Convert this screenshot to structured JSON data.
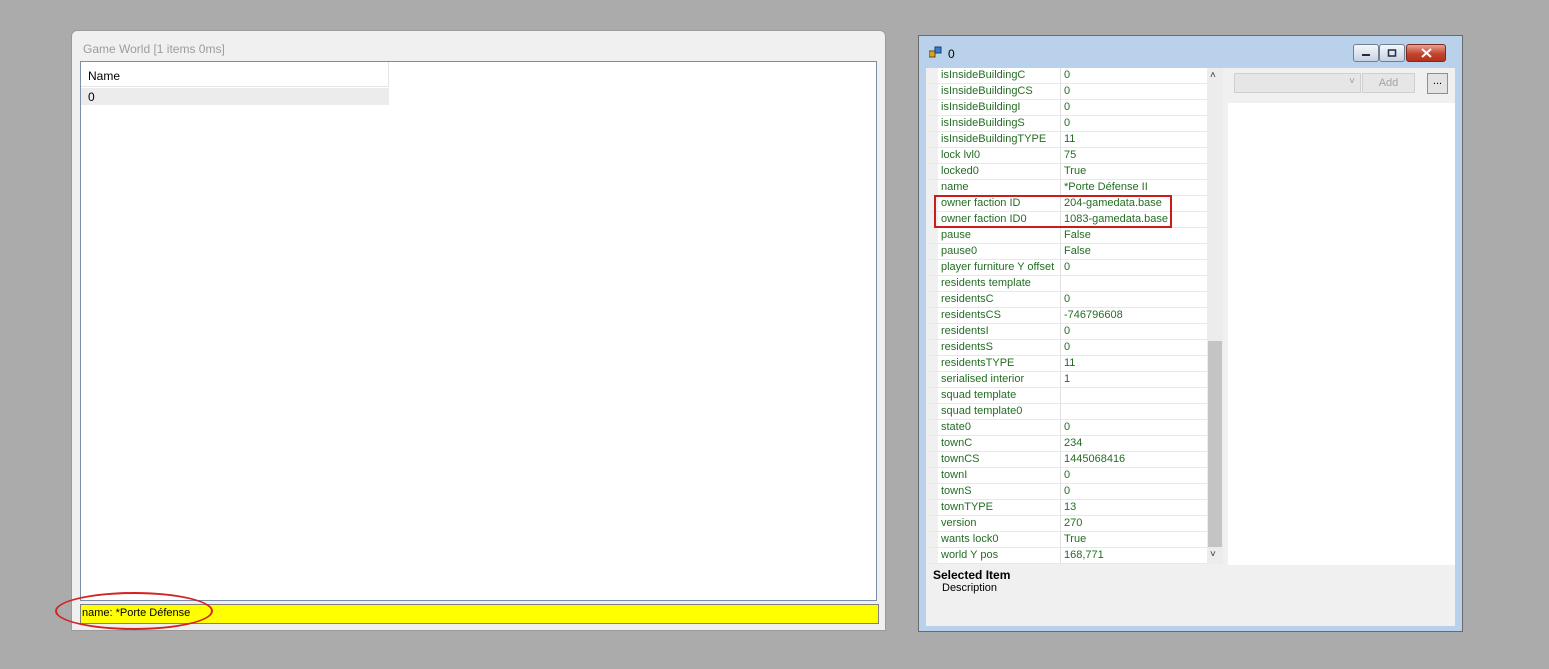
{
  "colors": {
    "desktop": "#ababab",
    "status_bar": "#ffff00",
    "property_text": "#226e22",
    "annotation": "#d42222"
  },
  "game_world": {
    "title": "Game World [1 items 0ms]",
    "column_header": "Name",
    "rows": [
      "0"
    ],
    "status_text": "name: *Porte Défense"
  },
  "property_window": {
    "title": "0",
    "icon": "app-icon",
    "properties": [
      {
        "name": "isInsideBuildingC",
        "value": "0"
      },
      {
        "name": "isInsideBuildingCS",
        "value": "0"
      },
      {
        "name": "isInsideBuildingI",
        "value": "0"
      },
      {
        "name": "isInsideBuildingS",
        "value": "0"
      },
      {
        "name": "isInsideBuildingTYPE",
        "value": "11"
      },
      {
        "name": "lock lvl0",
        "value": "75"
      },
      {
        "name": "locked0",
        "value": "True"
      },
      {
        "name": "name",
        "value": "*Porte Défense II"
      },
      {
        "name": "owner faction ID",
        "value": "204-gamedata.base"
      },
      {
        "name": "owner faction ID0",
        "value": "1083-gamedata.base"
      },
      {
        "name": "pause",
        "value": "False"
      },
      {
        "name": "pause0",
        "value": "False"
      },
      {
        "name": "player furniture Y offset",
        "value": "0"
      },
      {
        "name": "residents template",
        "value": ""
      },
      {
        "name": "residentsC",
        "value": "0"
      },
      {
        "name": "residentsCS",
        "value": "-746796608"
      },
      {
        "name": "residentsI",
        "value": "0"
      },
      {
        "name": "residentsS",
        "value": "0"
      },
      {
        "name": "residentsTYPE",
        "value": "11"
      },
      {
        "name": "serialised interior",
        "value": "1"
      },
      {
        "name": "squad template",
        "value": ""
      },
      {
        "name": "squad template0",
        "value": ""
      },
      {
        "name": "state0",
        "value": "0"
      },
      {
        "name": "townC",
        "value": "234"
      },
      {
        "name": "townCS",
        "value": "1445068416"
      },
      {
        "name": "townI",
        "value": "0"
      },
      {
        "name": "townS",
        "value": "0"
      },
      {
        "name": "townTYPE",
        "value": "13"
      },
      {
        "name": "version",
        "value": "270"
      },
      {
        "name": "wants lock0",
        "value": "True"
      },
      {
        "name": "world Y pos",
        "value": "168,771"
      }
    ],
    "selected_item_title": "Selected Item",
    "selected_item_description": "Description",
    "combo_value": "",
    "add_button_label": "Add",
    "more_button_label": "..."
  }
}
